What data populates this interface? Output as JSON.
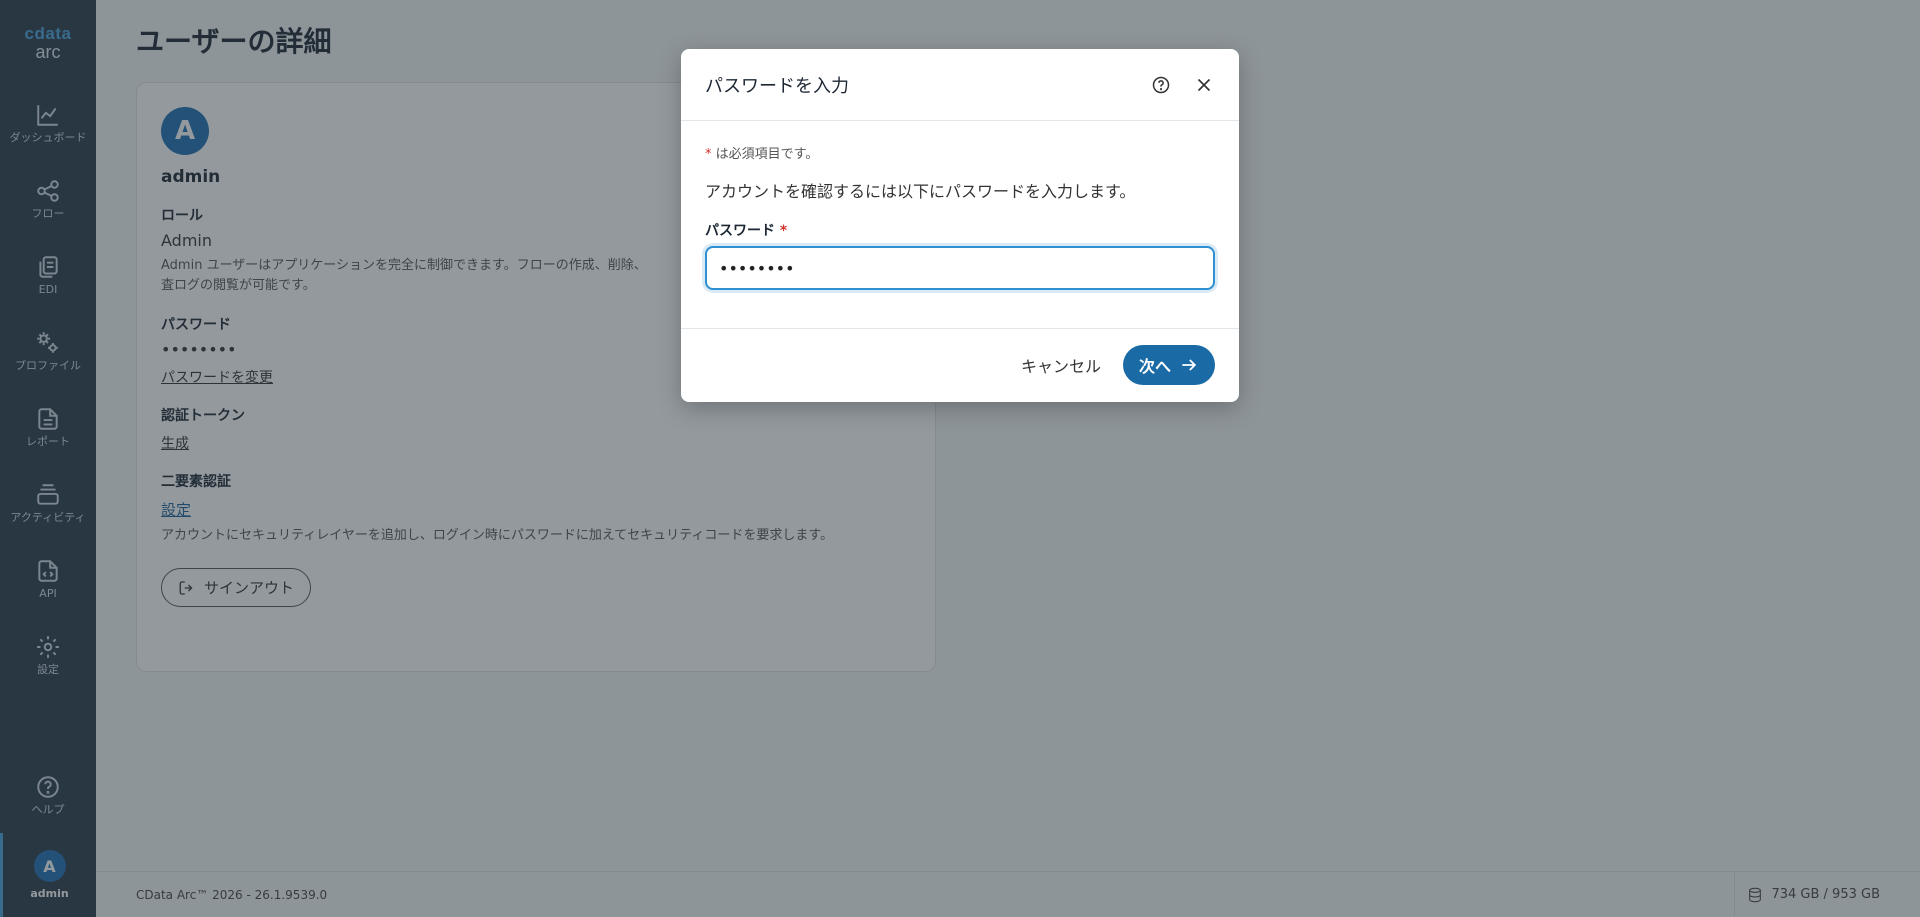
{
  "app": {
    "logo_top": "cdata",
    "logo_bottom": "arc",
    "version": "CData Arc™ 2026 - 26.1.9539.0",
    "storage": "734 GB / 953 GB"
  },
  "sidebar": {
    "items": [
      {
        "label": "ダッシュボード",
        "icon": "chart-line-icon"
      },
      {
        "label": "フロー",
        "icon": "share-nodes-icon"
      },
      {
        "label": "EDI",
        "icon": "copy-icon"
      },
      {
        "label": "プロファイル",
        "icon": "gears-icon"
      },
      {
        "label": "レポート",
        "icon": "file-text-icon"
      },
      {
        "label": "アクティビティ",
        "icon": "layers-icon"
      },
      {
        "label": "API",
        "icon": "file-code-icon"
      },
      {
        "label": "設定",
        "icon": "gear-icon"
      }
    ],
    "help_label": "ヘルプ",
    "user_initial": "A",
    "user_label": "admin"
  },
  "page": {
    "title": "ユーザーの詳細",
    "avatar_initial": "A",
    "username": "admin",
    "role_label": "ロール",
    "role_value": "Admin",
    "role_desc": "Admin ユーザーはアプリケーションを完全に制御できます。フローの作成、削除、",
    "role_desc2": "査ログの閲覧が可能です。",
    "password_label": "パスワード",
    "password_value": "••••••••",
    "change_password": "パスワードを変更",
    "token_label": "認証トークン",
    "token_generate": "生成",
    "twofa_label": "二要素認証",
    "twofa_setup": "設定",
    "twofa_desc": "アカウントにセキュリティレイヤーを追加し、ログイン時にパスワードに加えてセキュリティコードを要求します。",
    "signout": "サインアウト"
  },
  "modal": {
    "title": "パスワードを入力",
    "required_star": "*",
    "required_note": " は必須項目です。",
    "description": "アカウントを確認するには以下にパスワードを入力します。",
    "password_label": "パスワード",
    "password_value": "password",
    "cancel": "キャンセル",
    "next": "次へ"
  }
}
